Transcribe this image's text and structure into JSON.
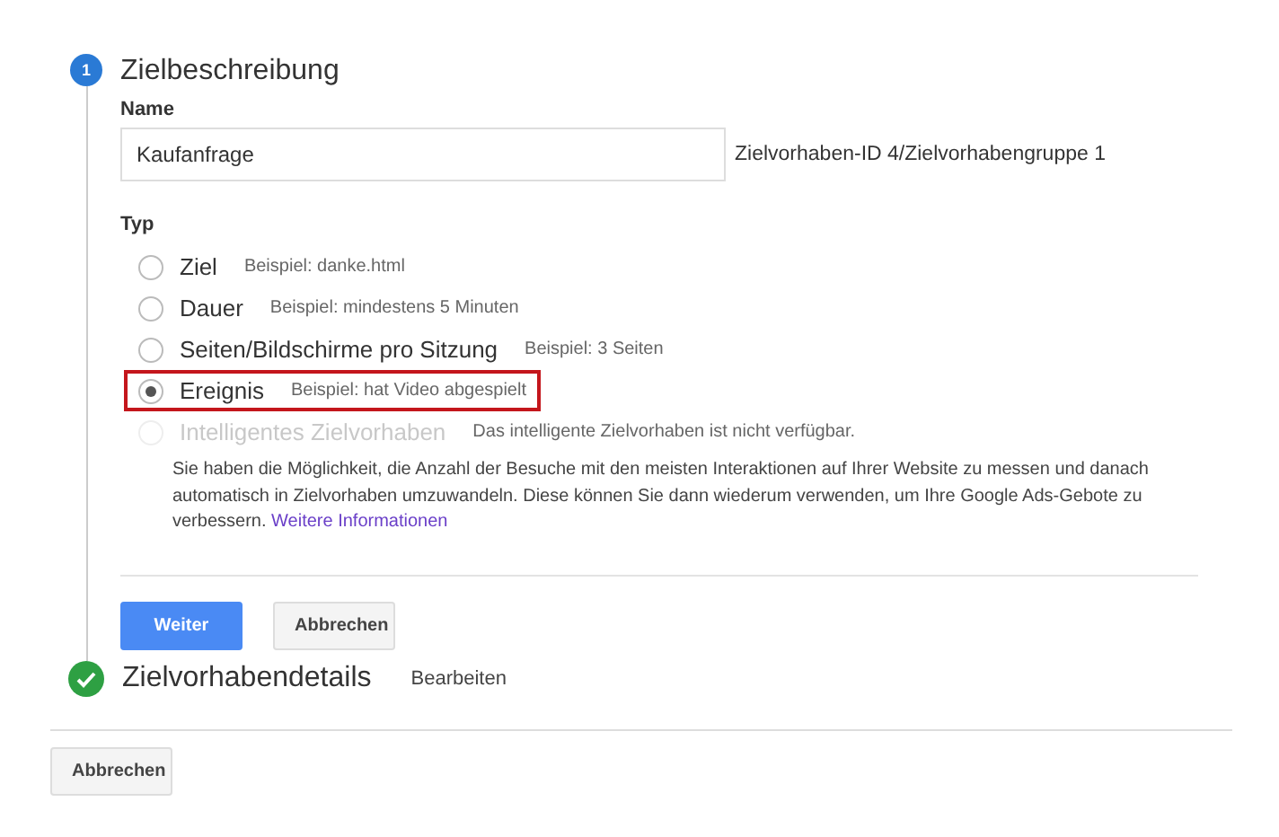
{
  "step1": {
    "number": "1",
    "title": "Zielbeschreibung",
    "name_label": "Name",
    "name_value": "Kaufanfrage",
    "goal_id": "Zielvorhaben-ID 4/Zielvorhabengruppe 1",
    "type_label": "Typ",
    "options": [
      {
        "label": "Ziel",
        "example": "Beispiel: danke.html",
        "selected": false,
        "disabled": false,
        "highlighted": false
      },
      {
        "label": "Dauer",
        "example": "Beispiel: mindestens 5 Minuten",
        "selected": false,
        "disabled": false,
        "highlighted": false
      },
      {
        "label": "Seiten/Bildschirme pro Sitzung",
        "example": "Beispiel: 3 Seiten",
        "selected": false,
        "disabled": false,
        "highlighted": false
      },
      {
        "label": "Ereignis",
        "example": "Beispiel: hat Video abgespielt",
        "selected": true,
        "disabled": false,
        "highlighted": true
      },
      {
        "label": "Intelligentes Zielvorhaben",
        "example": "Das intelligente Zielvorhaben ist nicht verfügbar.",
        "selected": false,
        "disabled": true,
        "highlighted": false
      }
    ],
    "description": "Sie haben die Möglichkeit, die Anzahl der Besuche mit den meisten Interaktionen auf Ihrer Website zu messen und danach automatisch in Zielvorhaben umzuwandeln. Diese können Sie dann wiederum verwenden, um Ihre Google Ads-Gebote zu verbessern.",
    "link": "Weitere Informationen",
    "buttons": [
      {
        "label": "Weiter",
        "kind": "primary"
      },
      {
        "label": "Abbrechen",
        "kind": "secondary"
      }
    ]
  },
  "step2": {
    "title": "Zielvorhabendetails",
    "edit": "Bearbeiten",
    "completed": true
  },
  "footer_button": "Abbrechen"
}
